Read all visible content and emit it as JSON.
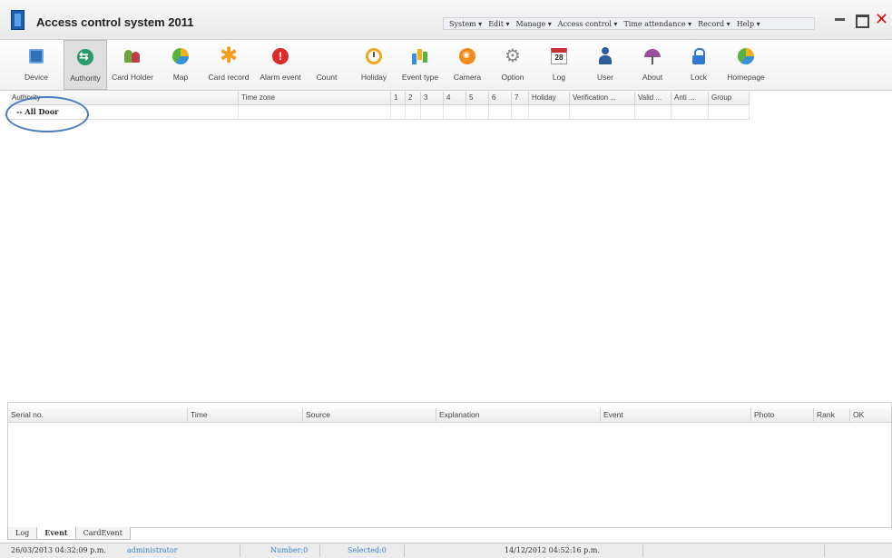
{
  "window": {
    "title": "Access control system 2011",
    "menu": [
      "System ▾",
      "Edit ▾",
      "Manage ▾",
      "Access control ▾",
      "Time attendance ▾",
      "Record ▾",
      "Help ▾"
    ]
  },
  "toolbar": {
    "items": [
      {
        "label": "Device",
        "icon": "device-icon"
      },
      {
        "label": "Authority",
        "icon": "authority-icon",
        "active": true
      },
      {
        "label": "Card Holder",
        "icon": "card-holder-icon"
      },
      {
        "label": "Map",
        "icon": "map-icon"
      },
      {
        "label": "Card record",
        "icon": "card-record-icon"
      },
      {
        "label": "Alarm event",
        "icon": "alarm-icon"
      },
      {
        "label": "Count",
        "icon": ""
      },
      {
        "label": "Holiday",
        "icon": "clock-icon"
      },
      {
        "label": "Event type",
        "icon": "bar-chart-icon"
      },
      {
        "label": "Camera",
        "icon": "camera-icon"
      },
      {
        "label": "Option",
        "icon": "gear-icon"
      },
      {
        "label": "Log",
        "icon": "calendar-icon",
        "icon_text": "28"
      },
      {
        "label": "User",
        "icon": "user-icon"
      },
      {
        "label": "About",
        "icon": "umbrella-icon"
      },
      {
        "label": "Lock",
        "icon": "lock-icon"
      },
      {
        "label": "Homepage",
        "icon": "homepage-icon"
      }
    ]
  },
  "authority_grid": {
    "columns": [
      "Authority",
      "Time zone",
      "1",
      "2",
      "3",
      "4",
      "5",
      "6",
      "7",
      "Holiday",
      "Verification ...",
      "Valid ...",
      "Anti ...",
      "Group"
    ],
    "tree_item": "-- All Door"
  },
  "event_grid": {
    "columns": [
      "Serial no.",
      "Time",
      "Source",
      "Explanation",
      "Event",
      "Photo",
      "Rank",
      "OK"
    ]
  },
  "tabs": [
    {
      "label": "Log",
      "active": false
    },
    {
      "label": "Event",
      "active": true
    },
    {
      "label": "CardEvent",
      "active": false
    }
  ],
  "status": {
    "datetime": "26/03/2013 04:32:09 p.m.",
    "user": "administrator",
    "number": "Number:0",
    "selected": "Selected:0",
    "datetime2": "14/12/2012 04:52:16 p.m."
  },
  "colors": {
    "accent": "#3a7fcf",
    "close": "#dd1111",
    "annotation": "#4e7bbe"
  }
}
